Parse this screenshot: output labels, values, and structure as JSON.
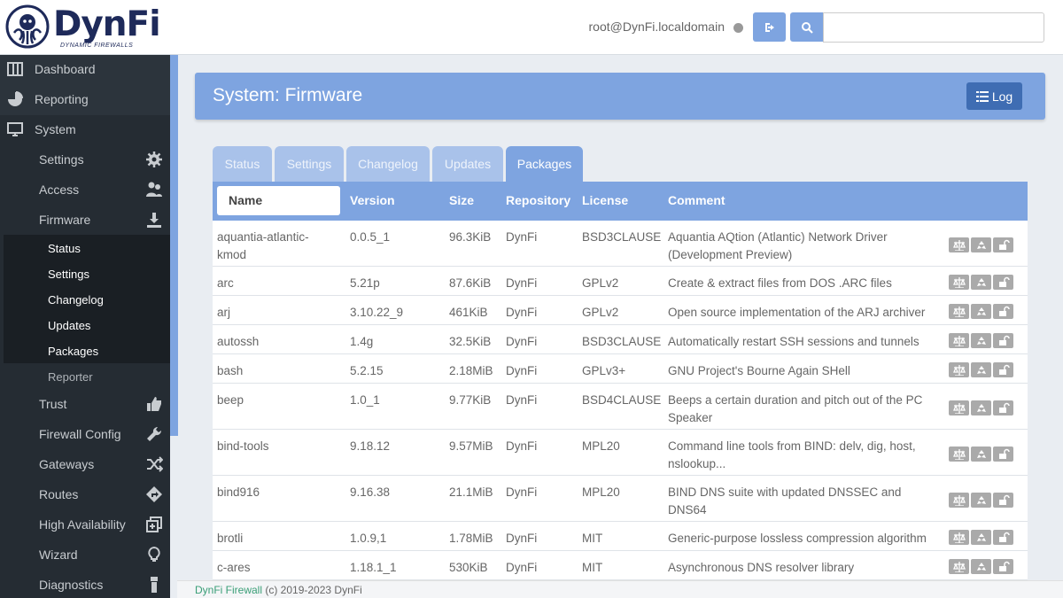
{
  "app": {
    "brand": "DynFi",
    "brand_tagline": "DYNAMIC FIREWALLS",
    "user": "root@DynFi.localdomain",
    "colors": {
      "accent": "#7ea4e0",
      "sidebar": "#2c343c",
      "button_dark": "#3f6db3"
    }
  },
  "sidebar": {
    "items": [
      {
        "label": "Dashboard",
        "icon": "dashboard-icon"
      },
      {
        "label": "Reporting",
        "icon": "pie-chart-icon"
      },
      {
        "label": "System",
        "icon": "monitor-icon"
      }
    ],
    "system_sub": [
      {
        "label": "Settings",
        "icon": "gear-icon"
      },
      {
        "label": "Access",
        "icon": "users-icon"
      },
      {
        "label": "Firmware",
        "icon": "download-icon"
      }
    ],
    "firmware_sub": [
      "Status",
      "Settings",
      "Changelog",
      "Updates",
      "Packages"
    ],
    "reporter": "Reporter",
    "system_sub2": [
      {
        "label": "Trust",
        "icon": "thumbs-up-icon"
      },
      {
        "label": "Firewall Config",
        "icon": "wrench-icon"
      },
      {
        "label": "Gateways",
        "icon": "shuffle-icon"
      },
      {
        "label": "Routes",
        "icon": "route-sign-icon"
      },
      {
        "label": "High Availability",
        "icon": "duplicate-icon"
      },
      {
        "label": "Wizard",
        "icon": "lightbulb-icon"
      },
      {
        "label": "Diagnostics",
        "icon": "flashlight-icon"
      }
    ]
  },
  "page": {
    "title": "System: Firmware",
    "log_button": "Log",
    "tabs": [
      "Status",
      "Settings",
      "Changelog",
      "Updates",
      "Packages"
    ],
    "active_tab": "Packages"
  },
  "table": {
    "columns": [
      "Name",
      "Version",
      "Size",
      "Repository",
      "License",
      "Comment"
    ],
    "rows": [
      {
        "name1": "aquantia-atlantic-",
        "name2": "kmod",
        "version": "0.0.5_1",
        "size": "96.3KiB",
        "repo": "DynFi",
        "license": "BSD3CLAUSE",
        "comment1": "Aquantia AQtion (Atlantic) Network Driver",
        "comment2": "(Development Preview)"
      },
      {
        "name1": "arc",
        "name2": "",
        "version": "5.21p",
        "size": "87.6KiB",
        "repo": "DynFi",
        "license": "GPLv2",
        "comment1": "Create & extract files from DOS .ARC files",
        "comment2": ""
      },
      {
        "name1": "arj",
        "name2": "",
        "version": "3.10.22_9",
        "size": "461KiB",
        "repo": "DynFi",
        "license": "GPLv2",
        "comment1": "Open source implementation of the ARJ archiver",
        "comment2": ""
      },
      {
        "name1": "autossh",
        "name2": "",
        "version": "1.4g",
        "size": "32.5KiB",
        "repo": "DynFi",
        "license": "BSD3CLAUSE",
        "comment1": "Automatically restart SSH sessions and tunnels",
        "comment2": ""
      },
      {
        "name1": "bash",
        "name2": "",
        "version": "5.2.15",
        "size": "2.18MiB",
        "repo": "DynFi",
        "license": "GPLv3+",
        "comment1": "GNU Project's Bourne Again SHell",
        "comment2": ""
      },
      {
        "name1": "beep",
        "name2": "",
        "version": "1.0_1",
        "size": "9.77KiB",
        "repo": "DynFi",
        "license": "BSD4CLAUSE",
        "comment1": "Beeps a certain duration and pitch out of the PC",
        "comment2": "Speaker"
      },
      {
        "name1": "bind-tools",
        "name2": "",
        "version": "9.18.12",
        "size": "9.57MiB",
        "repo": "DynFi",
        "license": "MPL20",
        "comment1": "Command line tools from BIND: delv, dig, host,",
        "comment2": "nslookup..."
      },
      {
        "name1": "bind916",
        "name2": "",
        "version": "9.16.38",
        "size": "21.1MiB",
        "repo": "DynFi",
        "license": "MPL20",
        "comment1": "BIND DNS suite with updated DNSSEC and",
        "comment2": "DNS64"
      },
      {
        "name1": "brotli",
        "name2": "",
        "version": "1.0.9,1",
        "size": "1.78MiB",
        "repo": "DynFi",
        "license": "MIT",
        "comment1": "Generic-purpose lossless compression algorithm",
        "comment2": ""
      },
      {
        "name1": "c-ares",
        "name2": "",
        "version": "1.18.1_1",
        "size": "530KiB",
        "repo": "DynFi",
        "license": "MIT",
        "comment1": "Asynchronous DNS resolver library",
        "comment2": ""
      }
    ]
  },
  "footer": {
    "link": "DynFi Firewall",
    "text": " (c) 2019-2023 DynFi"
  }
}
